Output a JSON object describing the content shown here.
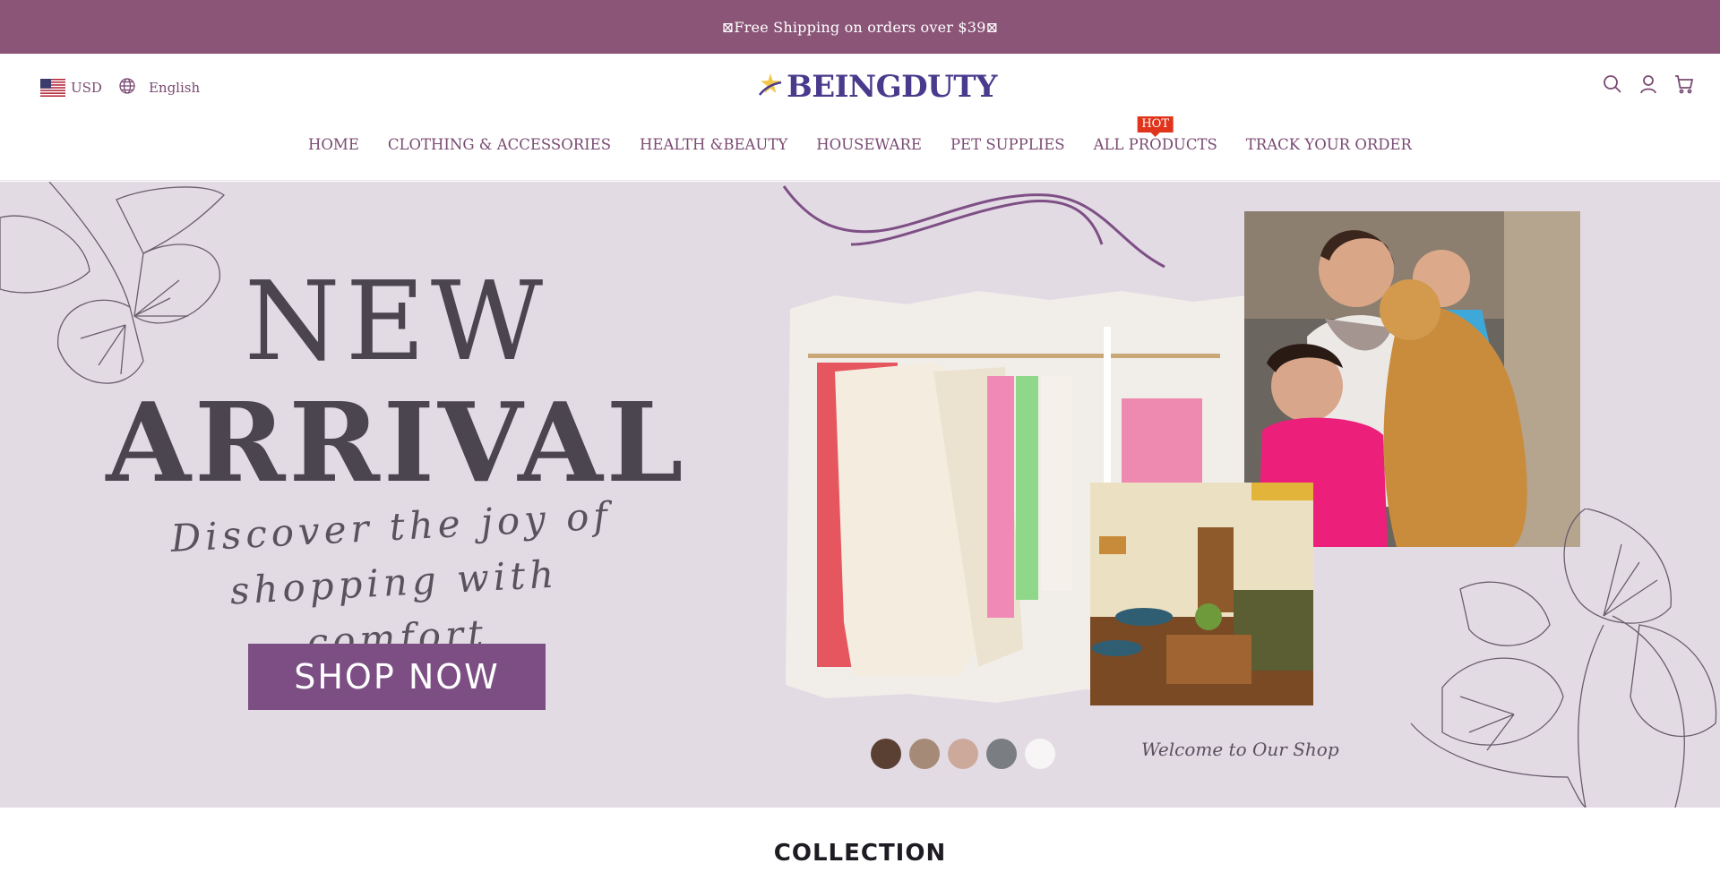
{
  "announcement": {
    "text": "⊠Free Shipping on orders over $39⊠"
  },
  "header": {
    "currency": "USD",
    "language": "English",
    "logo_text": "BEINGDUTY",
    "icons": [
      "search-icon",
      "account-icon",
      "cart-icon"
    ]
  },
  "nav": {
    "items": [
      {
        "label": "HOME"
      },
      {
        "label": "CLOTHING & ACCESSORIES"
      },
      {
        "label": "HEALTH &BEAUTY"
      },
      {
        "label": "HOUSEWARE"
      },
      {
        "label": "PET SUPPLIES"
      },
      {
        "label": "ALL PRODUCTS",
        "badge": "HOT"
      },
      {
        "label": "TRACK YOUR ORDER"
      }
    ]
  },
  "hero": {
    "headline_1": "NEW",
    "headline_2": "ARRIVAL",
    "script_line_1": "Discover the joy of",
    "script_line_2": "shopping with comfort",
    "cta": "SHOP NOW",
    "welcome": "Welcome to Our Shop",
    "swatch_colors": [
      "#5a4033",
      "#a68a78",
      "#cda99c",
      "#7a7d82",
      "#f7f5f6"
    ]
  },
  "section": {
    "title": "COLLECTION"
  },
  "colors": {
    "announcement_bg": "#8b5578",
    "nav_text": "#7a4a72",
    "logo": "#4a3a8c",
    "hot_badge": "#e0341c",
    "hero_bg": "#e2dbe4",
    "cta_bg": "#7c4e84"
  }
}
